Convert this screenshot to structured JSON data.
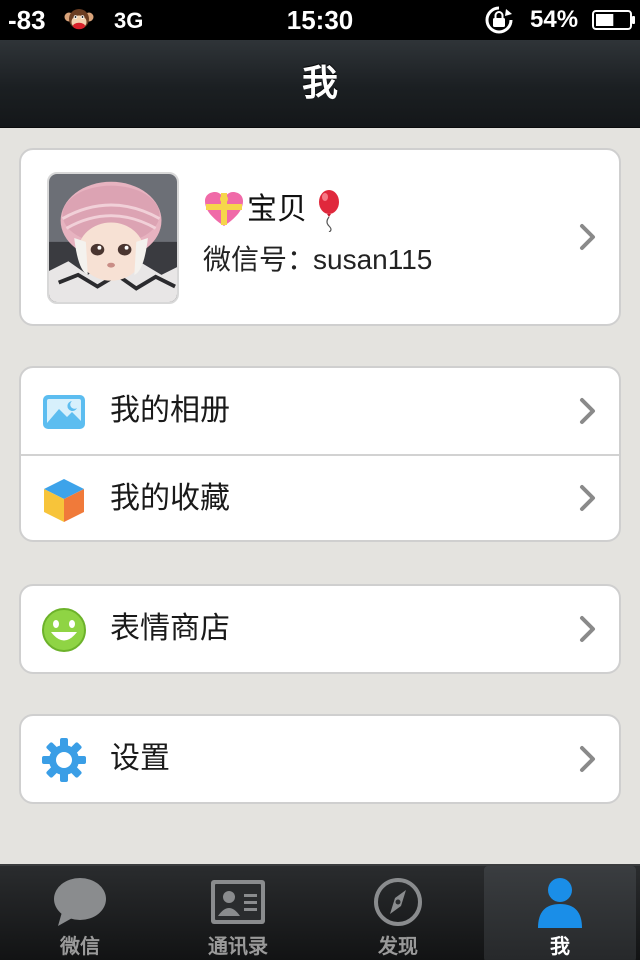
{
  "status_bar": {
    "signal": "-83",
    "network": "3G",
    "time": "15:30",
    "battery": "54%",
    "battery_level": 0.54
  },
  "nav": {
    "title": "我"
  },
  "profile": {
    "name": "宝贝",
    "wechat_id_label": "微信号：",
    "wechat_id": "susan115"
  },
  "menu": {
    "album": "我的相册",
    "favorites": "我的收藏",
    "sticker_store": "表情商店",
    "settings": "设置"
  },
  "tabs": [
    {
      "label": "微信",
      "icon": "chat-bubble-icon",
      "active": false
    },
    {
      "label": "通讯录",
      "icon": "contact-card-icon",
      "active": false
    },
    {
      "label": "发现",
      "icon": "compass-icon",
      "active": false
    },
    {
      "label": "我",
      "icon": "person-icon",
      "active": true
    }
  ],
  "colors": {
    "background": "#e4e3df",
    "accent": "#1a8ee8",
    "navbar": "#1b1f22"
  }
}
